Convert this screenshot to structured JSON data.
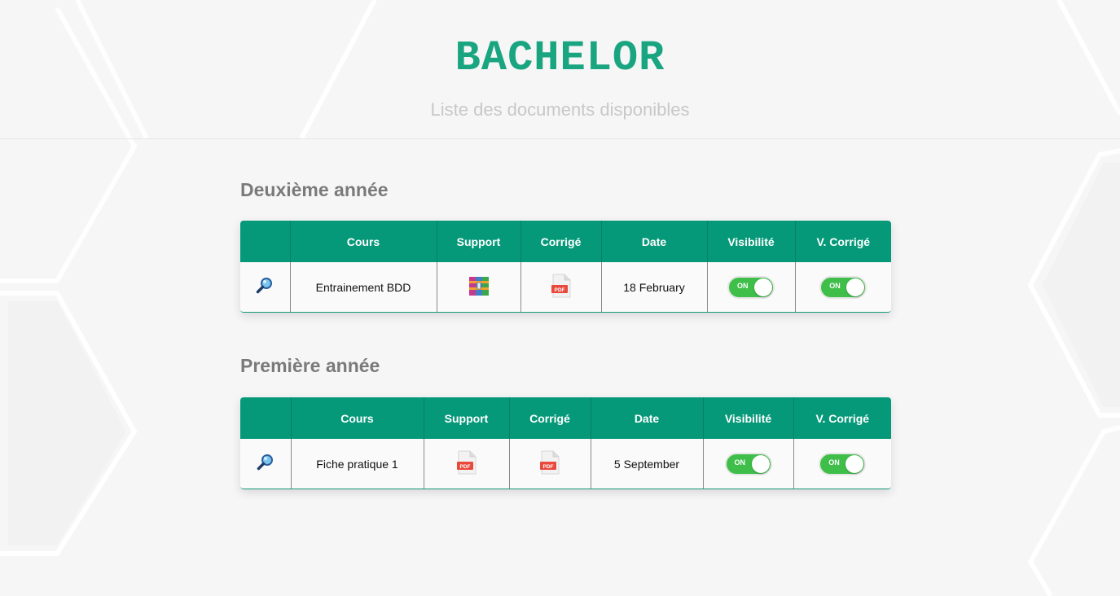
{
  "header": {
    "title": "BACHELOR",
    "subtitle": "Liste des documents disponibles"
  },
  "table_headers": [
    "Cours",
    "Support",
    "Corrigé",
    "Date",
    "Visibilité",
    "V. Corrigé"
  ],
  "sections": [
    {
      "title": "Deuxième année",
      "rows": [
        {
          "course": "Entrainement BDD",
          "support_icon": "archive-rar-icon",
          "corrige_icon": "pdf-icon",
          "date": "18 February",
          "visibility": "ON",
          "v_corrige": "ON"
        }
      ]
    },
    {
      "title": "Première année",
      "rows": [
        {
          "course": "Fiche pratique 1",
          "support_icon": "pdf-icon",
          "corrige_icon": "pdf-icon",
          "date": "5 September",
          "visibility": "ON",
          "v_corrige": "ON"
        }
      ]
    }
  ],
  "icons": {
    "view": "magnifier-icon",
    "pdf_label": "PDF"
  },
  "colors": {
    "accent": "#069979",
    "title": "#1aa581",
    "toggle_on": "#3fbf4a"
  }
}
